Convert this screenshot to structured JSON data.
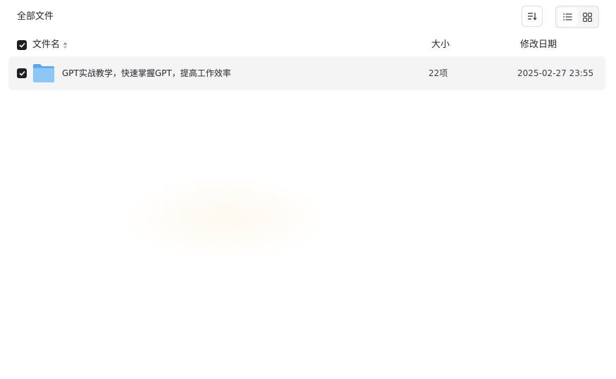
{
  "breadcrumb": {
    "label": "全部文件"
  },
  "toolbar": {
    "sort_icon": "sort-icon",
    "list_view_icon": "list-view-icon",
    "grid_view_icon": "grid-view-icon",
    "active_view": "list"
  },
  "table": {
    "columns": {
      "name": "文件名",
      "size": "大小",
      "date": "修改日期"
    },
    "rows": [
      {
        "icon": "folder-icon",
        "name": "GPT实战教学，快速掌握GPT，提高工作效率",
        "size": "22项",
        "date": "2025-02-27 23:55",
        "checked": true
      }
    ]
  },
  "colors": {
    "checkbox": "#1f1f23",
    "row_bg": "#f4f4f5",
    "folder": "#6fb6f2"
  }
}
